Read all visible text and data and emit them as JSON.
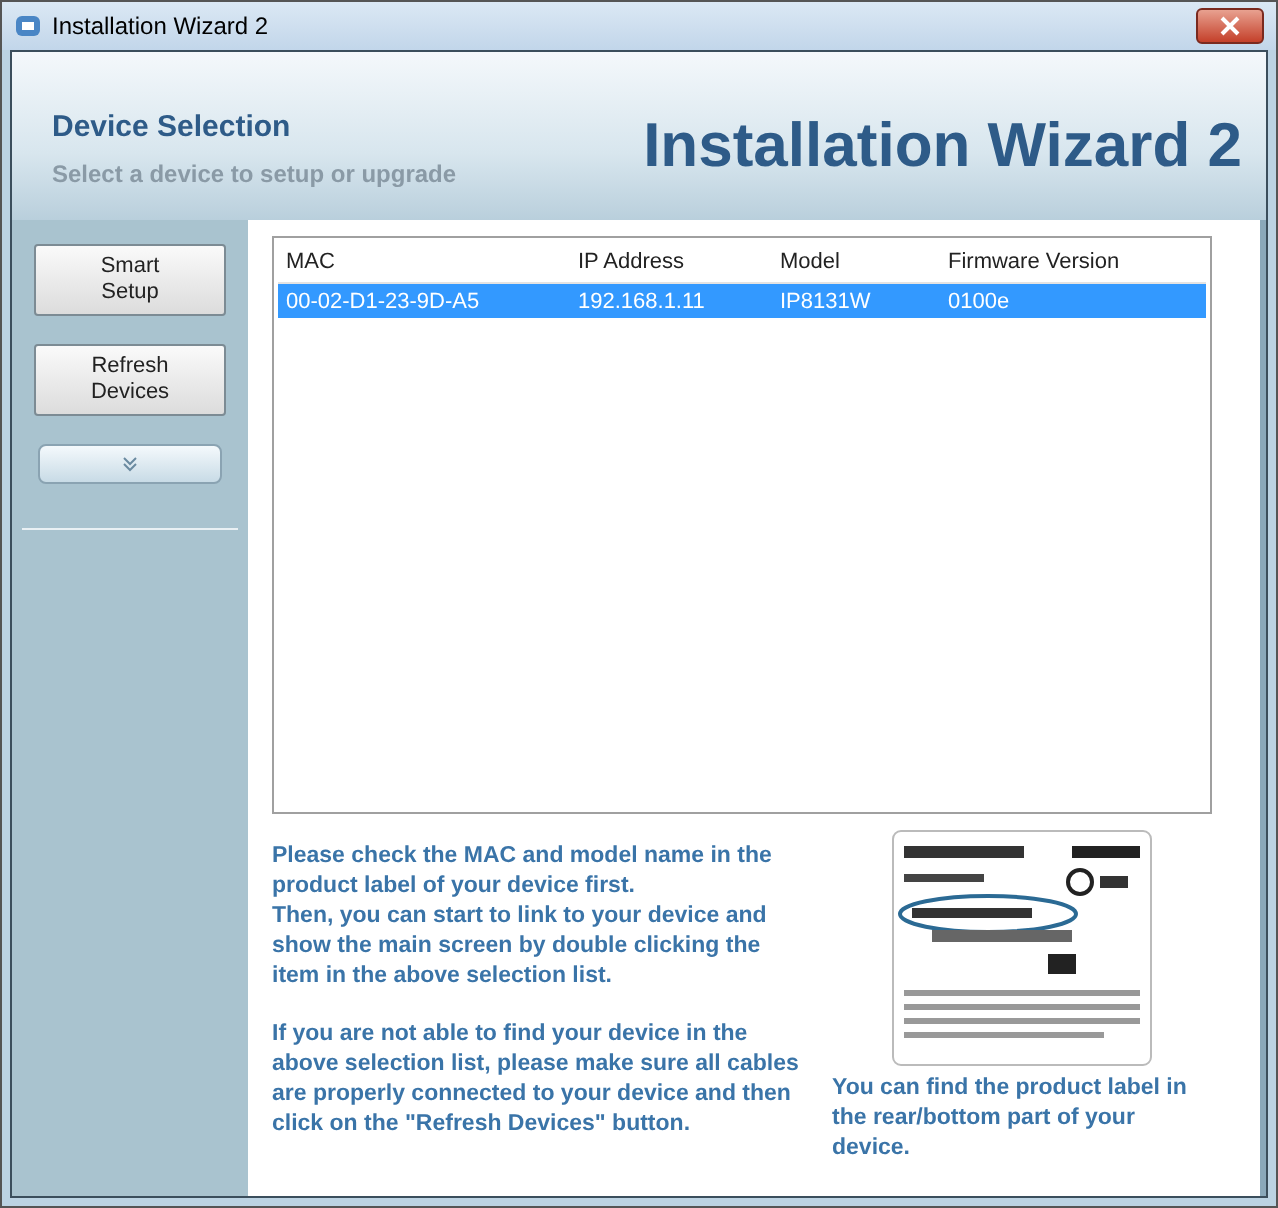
{
  "window": {
    "title": "Installation Wizard 2"
  },
  "header": {
    "title": "Device Selection",
    "subtitle": "Select a device to setup or upgrade",
    "banner": "Installation Wizard 2"
  },
  "sidebar": {
    "buttons": [
      "Smart\nSetup",
      "Refresh\nDevices"
    ]
  },
  "table": {
    "columns": [
      "MAC",
      "IP Address",
      "Model",
      "Firmware Version"
    ],
    "rows": [
      {
        "cells": [
          "00-02-D1-23-9D-A5",
          "192.168.1.11",
          "IP8131W",
          "0100e"
        ],
        "selected": true
      }
    ]
  },
  "instructions": [
    "Please check the MAC and model name in the product label of your device first.\nThen, you can start to link to your device and show the main screen by double clicking the item in the above selection list.",
    "If you are not able to find your device in the above selection list, please make sure all cables are properly connected to your device and then click on the \"Refresh Devices\" button."
  ],
  "label_hint": {
    "caption": "You can find the product label in the rear/bottom part of your device."
  }
}
